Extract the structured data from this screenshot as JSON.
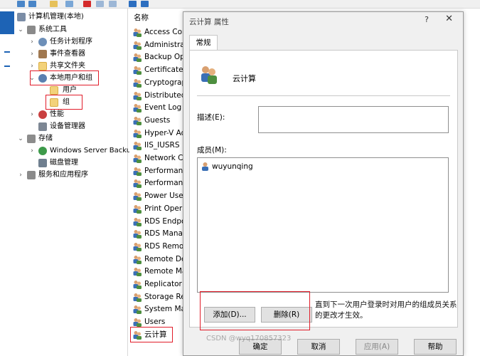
{
  "tree": {
    "items": [
      {
        "label": "计算机管理(本地)",
        "icon": "computer-icon"
      },
      {
        "label": "系统工具",
        "icon": "tools-icon"
      },
      {
        "label": "任务计划程序",
        "icon": "clock-icon"
      },
      {
        "label": "事件查看器",
        "icon": "event-viewer-icon"
      },
      {
        "label": "共享文件夹",
        "icon": "shared-folder-icon"
      },
      {
        "label": "本地用户和组",
        "icon": "users-icon"
      },
      {
        "label": "用户",
        "icon": "folder-icon"
      },
      {
        "label": "组",
        "icon": "folder-icon"
      },
      {
        "label": "性能",
        "icon": "performance-icon"
      },
      {
        "label": "设备管理器",
        "icon": "device-manager-icon"
      },
      {
        "label": "存储",
        "icon": "storage-icon"
      },
      {
        "label": "Windows Server Backup",
        "icon": "backup-icon"
      },
      {
        "label": "磁盘管理",
        "icon": "disk-icon"
      },
      {
        "label": "服务和应用程序",
        "icon": "services-icon"
      }
    ]
  },
  "list": {
    "header": "名称",
    "items": [
      "Access Control Assistance Operators",
      "Administrators",
      "Backup Operators",
      "Certificate Service DCOM Access",
      "Cryptographic Operators",
      "Distributed COM Users",
      "Event Log Readers",
      "Guests",
      "Hyper-V Administrators",
      "IIS_IUSRS",
      "Network Configuration Operators",
      "Performance Log Users",
      "Performance Monitor Users",
      "Power Users",
      "Print Operators",
      "RDS Endpoint Servers",
      "RDS Management Servers",
      "RDS Remote Access Servers",
      "Remote Desktop Users",
      "Remote Management Users",
      "Replicator",
      "Storage Replica Administrators",
      "System Managed Accounts Group",
      "Users",
      "云计算"
    ]
  },
  "dialog": {
    "title": "云计算 属性",
    "help_glyph": "?",
    "close_glyph": "✕",
    "tab_general": "常规",
    "group_name": "云计算",
    "desc_label": "描述(E):",
    "desc_value": "",
    "members_label": "成员(M):",
    "members": [
      "wuyunqing"
    ],
    "add_button": "添加(D)...",
    "remove_button": "删除(R)",
    "note": "直到下一次用户登录时对用户的组成员关系的更改才生效。",
    "ok_button": "确定",
    "cancel_button": "取消",
    "apply_button": "应用(A)",
    "help_button": "帮助"
  },
  "watermark": "CSDN @wyq170857323",
  "colors": {
    "highlight": "#e11d2a",
    "accent": "#1d63b5",
    "dialog_bg": "#f0f0f0"
  }
}
